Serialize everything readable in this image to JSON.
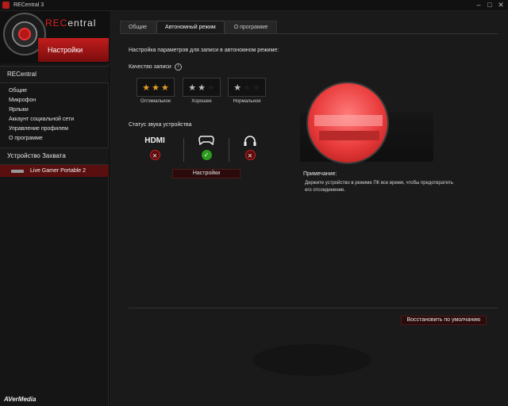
{
  "window": {
    "title": "RECentral 3",
    "minimize": "–",
    "maximize": "□",
    "close": "✕"
  },
  "sidebar": {
    "logo": {
      "rec": "REC",
      "rest": "entral"
    },
    "banner": "Настройки",
    "section_title": "RECentral",
    "items": [
      {
        "label": "Общие"
      },
      {
        "label": "Микрофон"
      },
      {
        "label": "Ярлыки"
      },
      {
        "label": "Аккаунт социальной сети"
      },
      {
        "label": "Управление профилем"
      },
      {
        "label": "О программе"
      }
    ],
    "device_section_title": "Устройство Захвата",
    "device": {
      "label": "Live Gamer Portable 2"
    },
    "brand": "AVerMedia"
  },
  "tabs": [
    {
      "label": "Общие",
      "active": false
    },
    {
      "label": "Автономный режим",
      "active": true
    },
    {
      "label": "О программе",
      "active": false
    }
  ],
  "main": {
    "panel_title": "Настройка параметров для записи в автономном режиме:",
    "quality_label": "Качество записи",
    "quality_info_icon": "i",
    "quality_options": [
      {
        "caption": "Оптимальное",
        "stars_filled": 3,
        "colors": [
          "#e8a02a",
          "#e8a02a",
          "#e8a02a"
        ]
      },
      {
        "caption": "Хорошее",
        "stars_filled": 2,
        "colors": [
          "#bdbdbd",
          "#bdbdbd",
          "#1e1e1e"
        ]
      },
      {
        "caption": "Нормальное",
        "stars_filled": 1,
        "colors": [
          "#bdbdbd",
          "#1e1e1e",
          "#1e1e1e"
        ]
      }
    ],
    "star_glyph": "★",
    "sound_label": "Статус звука устройства",
    "sound_sources": [
      {
        "caption": "HDMI",
        "icon": "hdmi-icon",
        "status": "muted",
        "status_glyph": "⨯"
      },
      {
        "caption": "",
        "icon": "gamepad-icon",
        "status": "enabled",
        "status_glyph": "✓"
      },
      {
        "caption": "",
        "icon": "headset-icon",
        "status": "muted",
        "status_glyph": "⨯"
      }
    ],
    "settings_button": "Настройки",
    "note_title": "Примечание:",
    "note_text": "Держите устройство в режиме ПК все время, чтобы предотвратить его отсоединение.",
    "restore_button": "Восстановить по умолчанию"
  },
  "colors": {
    "accent": "#b51b1b",
    "ok": "#2c9a1c",
    "star_gold": "#e8a02a"
  }
}
